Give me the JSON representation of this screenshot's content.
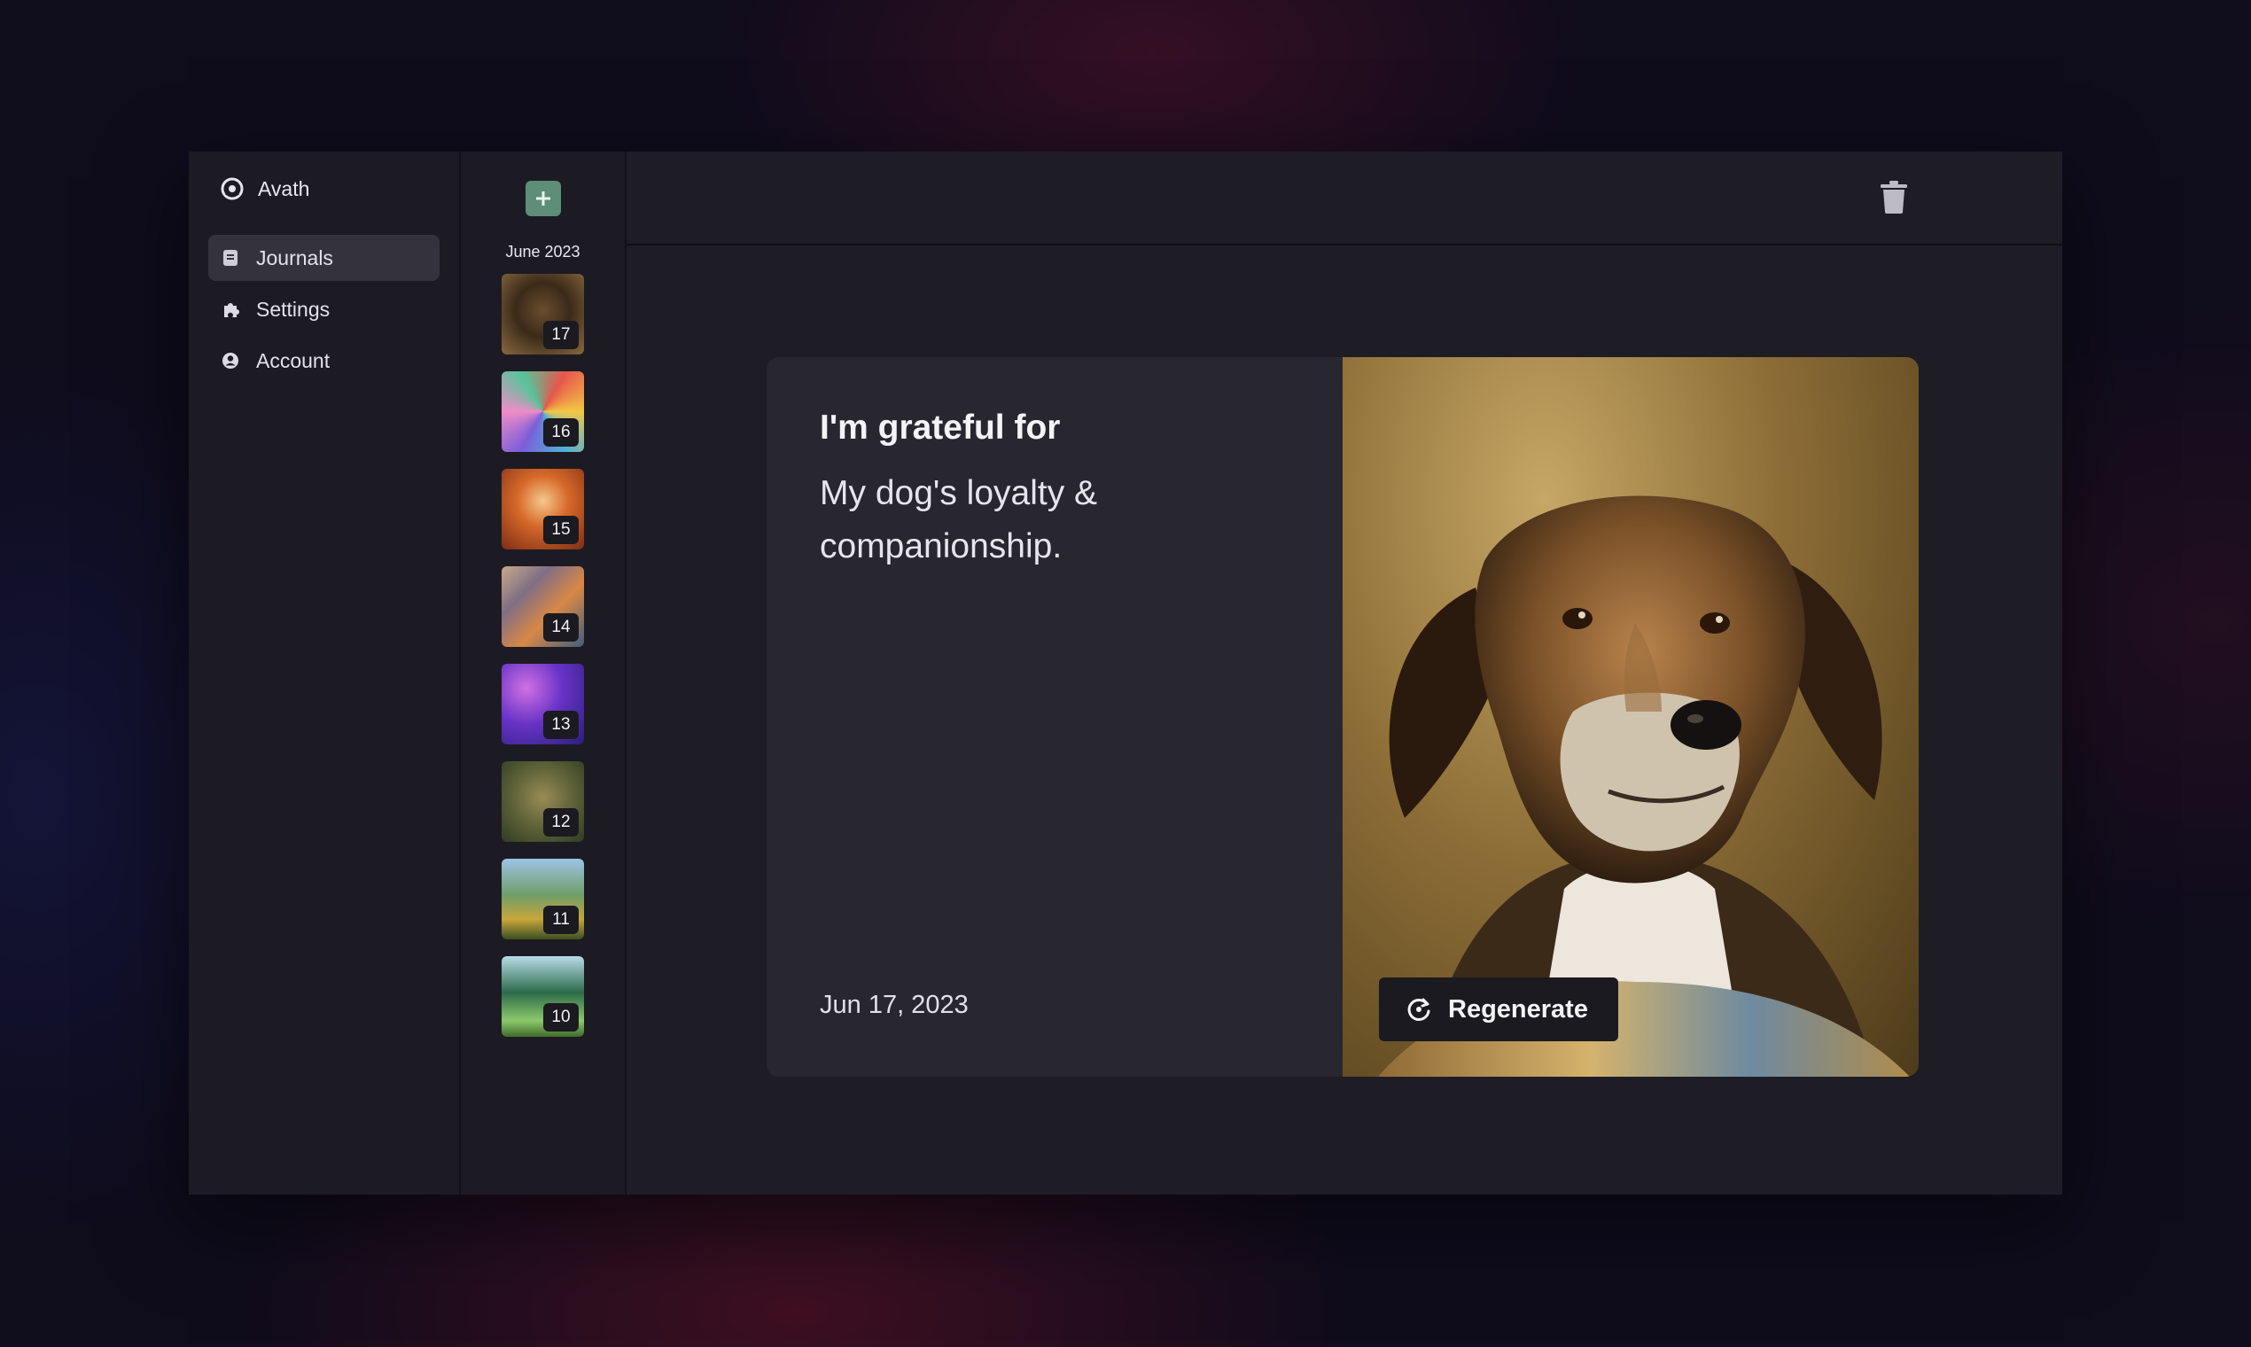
{
  "brand": {
    "name": "Avath"
  },
  "nav": {
    "items": [
      {
        "label": "Journals",
        "icon": "journal-icon",
        "active": true
      },
      {
        "label": "Settings",
        "icon": "puzzle-icon",
        "active": false
      },
      {
        "label": "Account",
        "icon": "user-circle-icon",
        "active": false
      }
    ]
  },
  "timeline": {
    "month": "June 2023",
    "entries": [
      {
        "day": "17"
      },
      {
        "day": "16"
      },
      {
        "day": "15"
      },
      {
        "day": "14"
      },
      {
        "day": "13"
      },
      {
        "day": "12"
      },
      {
        "day": "11"
      },
      {
        "day": "10"
      }
    ]
  },
  "entry": {
    "prompt": "I'm grateful for",
    "answer": "My dog's loyalty & companionship.",
    "date": "Jun 17, 2023",
    "regenerate_label": "Regenerate"
  },
  "colors": {
    "accent_green": "#5e8d78",
    "panel": "#1e1d25",
    "card": "#28272f"
  }
}
